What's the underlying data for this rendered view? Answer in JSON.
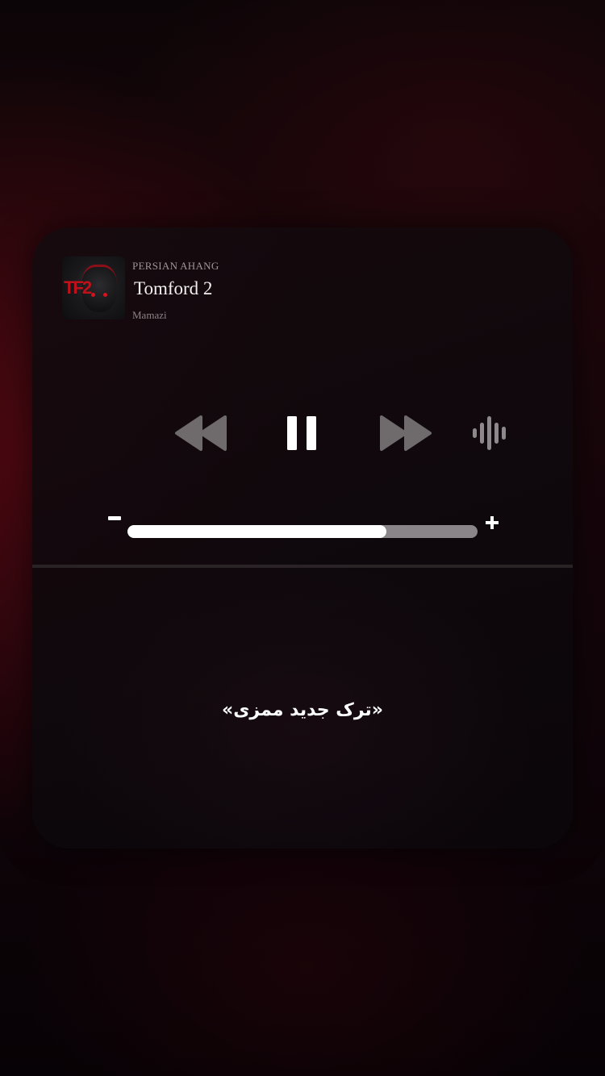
{
  "now_playing": {
    "source": "PERSIAN AHANG",
    "title": "Tomford 2",
    "artist": "Mamazi",
    "artwork_icon": "album-art",
    "artwork_text": "TF2"
  },
  "controls": {
    "rewind_icon": "rewind-icon",
    "pause_icon": "pause-icon",
    "forward_icon": "fast-forward-icon",
    "audio_icon": "audio-waveform-icon"
  },
  "volume": {
    "minus_label": "-",
    "plus_label": "+",
    "level_percent": 74
  },
  "caption": "«ترک جدید ممزی»",
  "colors": {
    "accent": "#ffffff",
    "track": "#8a8588",
    "card": "#140a0e",
    "background": "#12050a"
  }
}
